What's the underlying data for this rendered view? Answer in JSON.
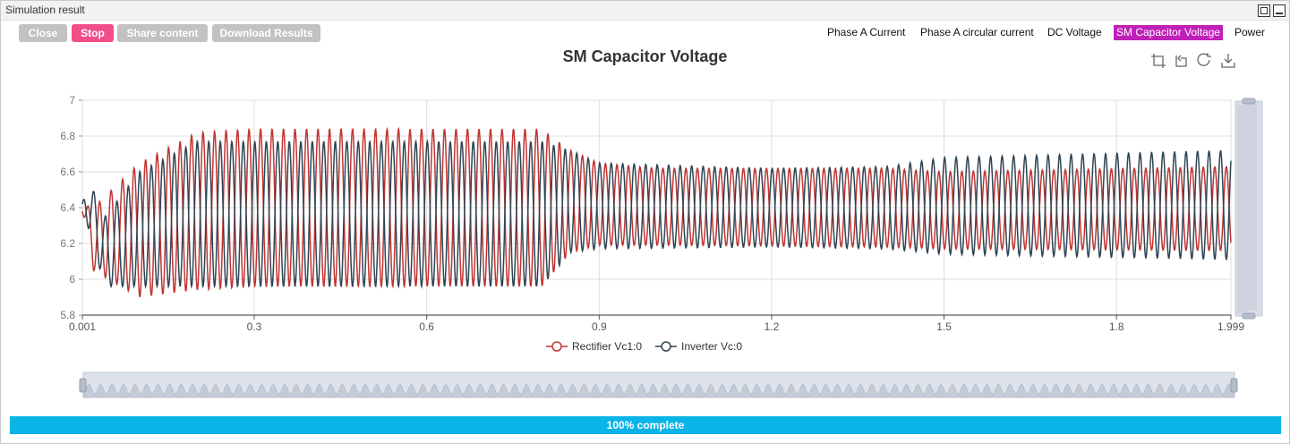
{
  "window": {
    "title": "Simulation result"
  },
  "toolbar": {
    "close_label": "Close",
    "stop_label": "Stop",
    "share_label": "Share content",
    "download_label": "Download Results"
  },
  "tabs": [
    {
      "label": "Phase A Current",
      "active": false
    },
    {
      "label": "Phase A circular current",
      "active": false
    },
    {
      "label": "DC Voltage",
      "active": false
    },
    {
      "label": "SM Capacitor Voltage",
      "active": true
    },
    {
      "label": "Power",
      "active": false
    }
  ],
  "chart_tools": [
    "zoom-icon",
    "zoom-reset-icon",
    "restore-icon",
    "save-image-icon"
  ],
  "colors": {
    "series1": "#c23531",
    "series2": "#2f4554",
    "active_tab": "#c020b8",
    "stop": "#f24e8a",
    "progress": "#0bb4e6"
  },
  "chart_data": {
    "type": "line",
    "title": "SM Capacitor Voltage",
    "xlim": [
      0.001,
      1.999
    ],
    "ylim": [
      5.8,
      7
    ],
    "x_ticks": [
      "0.001",
      "0.3",
      "0.6",
      "0.9",
      "1.2",
      "1.5",
      "1.8",
      "1.999"
    ],
    "y_ticks": [
      "5.8",
      "6",
      "6.2",
      "6.4",
      "6.6",
      "6.8",
      "7"
    ],
    "grid": true,
    "legend_position": "bottom",
    "series": [
      {
        "name": "Rectifier Vc1:0",
        "period": 0.02,
        "envelope": [
          {
            "x": 0.001,
            "min": 6.38,
            "max": 6.42
          },
          {
            "x": 0.02,
            "min": 6.05,
            "max": 6.4
          },
          {
            "x": 0.1,
            "min": 5.9,
            "max": 6.65
          },
          {
            "x": 0.2,
            "min": 5.94,
            "max": 6.82
          },
          {
            "x": 0.3,
            "min": 5.96,
            "max": 6.84
          },
          {
            "x": 0.8,
            "min": 5.96,
            "max": 6.84
          },
          {
            "x": 0.85,
            "min": 6.15,
            "max": 6.72
          },
          {
            "x": 0.9,
            "min": 6.19,
            "max": 6.65
          },
          {
            "x": 1.0,
            "min": 6.19,
            "max": 6.62
          },
          {
            "x": 1.4,
            "min": 6.18,
            "max": 6.62
          },
          {
            "x": 1.5,
            "min": 6.17,
            "max": 6.6
          },
          {
            "x": 1.999,
            "min": 6.16,
            "max": 6.63
          }
        ]
      },
      {
        "name": "Inverter Vc:0",
        "period": 0.02,
        "envelope": [
          {
            "x": 0.001,
            "min": 6.38,
            "max": 6.42
          },
          {
            "x": 0.01,
            "min": 6.3,
            "max": 6.57
          },
          {
            "x": 0.04,
            "min": 5.96,
            "max": 6.35
          },
          {
            "x": 0.1,
            "min": 5.96,
            "max": 6.6
          },
          {
            "x": 0.2,
            "min": 5.96,
            "max": 6.77
          },
          {
            "x": 0.8,
            "min": 5.96,
            "max": 6.77
          },
          {
            "x": 0.85,
            "min": 6.15,
            "max": 6.72
          },
          {
            "x": 0.9,
            "min": 6.17,
            "max": 6.65
          },
          {
            "x": 1.2,
            "min": 6.18,
            "max": 6.62
          },
          {
            "x": 1.4,
            "min": 6.17,
            "max": 6.63
          },
          {
            "x": 1.5,
            "min": 6.14,
            "max": 6.68
          },
          {
            "x": 1.999,
            "min": 6.11,
            "max": 6.72
          }
        ]
      }
    ]
  },
  "progress": {
    "percent": 100,
    "label": "100% complete"
  }
}
